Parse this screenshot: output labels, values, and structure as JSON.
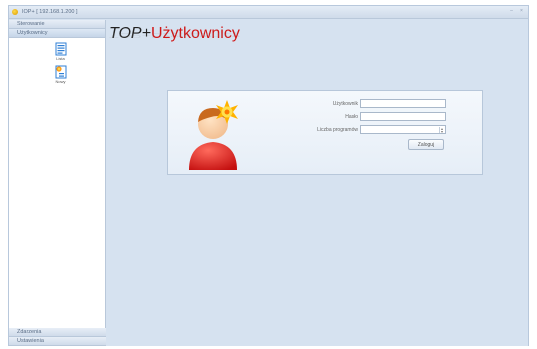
{
  "window": {
    "title": "IOP+ [ 192.168.1.200 ]"
  },
  "sidebar": {
    "top_sections": [
      {
        "label": "Sterowanie"
      },
      {
        "label": "Użytkownicy"
      }
    ],
    "icons": [
      {
        "icon": "document-list-icon",
        "label": "Lista"
      },
      {
        "icon": "document-new-icon",
        "label": "Nowy"
      }
    ],
    "bottom_sections": [
      {
        "label": "Zdarzenia"
      },
      {
        "label": "Ustawienia"
      }
    ]
  },
  "header": {
    "prefix": "TOP+",
    "title": "Użytkownicy"
  },
  "login": {
    "fields": [
      {
        "label": "Użytkownik",
        "value": ""
      },
      {
        "label": "Hasło",
        "value": ""
      },
      {
        "label": "Liczba programów",
        "value": ""
      }
    ],
    "button_label": "Zaloguj"
  },
  "colors": {
    "title_red": "#d01616",
    "frame_blue": "#d6e2f0"
  }
}
